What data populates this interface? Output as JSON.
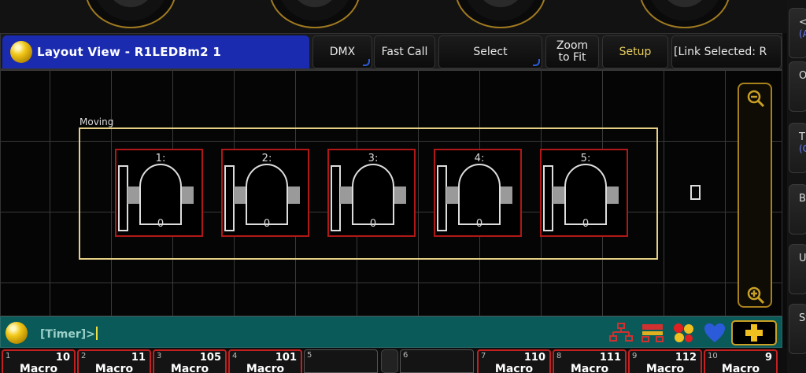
{
  "title_bar": {
    "title": "Layout View - R1LEDBm2 1",
    "buttons": [
      {
        "label": "DMX"
      },
      {
        "label": "Fast Call"
      },
      {
        "label": "Select"
      },
      {
        "label": "Zoom to Fit"
      },
      {
        "label": "Setup",
        "active": true
      },
      {
        "label": "[Link Selected: R"
      }
    ]
  },
  "right_strip": [
    {
      "label": "<",
      "sub": "(A"
    },
    {
      "label": "O",
      "sub": ""
    },
    {
      "label": "T",
      "sub": "(C"
    },
    {
      "label": "B",
      "sub": ""
    },
    {
      "label": "Up",
      "sub": ""
    },
    {
      "label": "St",
      "sub": ""
    }
  ],
  "layout": {
    "group_label": "Moving",
    "fixtures": [
      {
        "label": "1:",
        "value": "0"
      },
      {
        "label": "2:",
        "value": "0"
      },
      {
        "label": "3:",
        "value": "0"
      },
      {
        "label": "4:",
        "value": "0"
      },
      {
        "label": "5:",
        "value": "0"
      }
    ]
  },
  "command_line": {
    "prompt": "[Timer]>"
  },
  "executors": [
    {
      "num": "1",
      "count": "10",
      "name": "Macro"
    },
    {
      "num": "2",
      "count": "11",
      "name": "Macro"
    },
    {
      "num": "3",
      "count": "105",
      "name": "Macro"
    },
    {
      "num": "4",
      "count": "101",
      "name": "Macro"
    },
    {
      "num": "5",
      "count": "",
      "name": ""
    },
    {
      "num": "6",
      "count": "",
      "name": ""
    },
    {
      "num": "7",
      "count": "110",
      "name": "Macro"
    },
    {
      "num": "8",
      "count": "111",
      "name": "Macro"
    },
    {
      "num": "9",
      "count": "112",
      "name": "Macro"
    },
    {
      "num": "10",
      "count": "9",
      "name": "Macro"
    }
  ],
  "colors": {
    "title_blue": "#1a2bb0",
    "accent_gold": "#c9a025",
    "fixture_red": "#b01818",
    "cmd_teal": "#0a5a5a"
  }
}
